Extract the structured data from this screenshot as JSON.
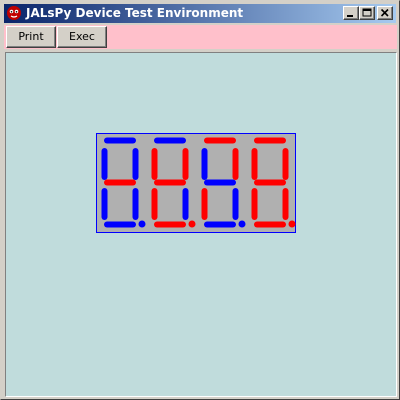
{
  "window": {
    "title": "JALsPy  Device Test Environment"
  },
  "toolbar": {
    "print_label": "Print",
    "exec_label": "Exec"
  },
  "colors": {
    "blue": "#0000ff",
    "red": "#ff0000",
    "off": "#b0b0b0",
    "display_border": "#0000ff"
  },
  "display": {
    "digits": [
      {
        "a": "blue",
        "b": "blue",
        "c": "blue",
        "d": "blue",
        "e": "blue",
        "f": "blue",
        "g": "red",
        "dp": "blue"
      },
      {
        "a": "blue",
        "b": "red",
        "c": "blue",
        "d": "red",
        "e": "red",
        "f": "red",
        "g": "red",
        "dp": "red"
      },
      {
        "a": "red",
        "b": "red",
        "c": "blue",
        "d": "blue",
        "e": "red",
        "f": "blue",
        "g": "blue",
        "dp": "blue"
      },
      {
        "a": "red",
        "b": "red",
        "c": "red",
        "d": "red",
        "e": "red",
        "f": "red",
        "g": "red",
        "dp": "red"
      }
    ]
  }
}
